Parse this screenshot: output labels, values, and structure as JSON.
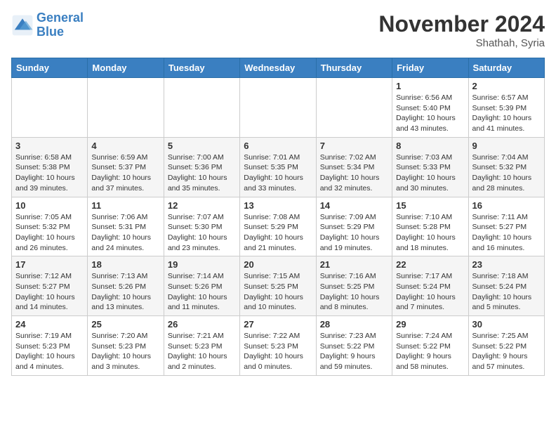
{
  "logo": {
    "line1": "General",
    "line2": "Blue"
  },
  "title": "November 2024",
  "location": "Shathah, Syria",
  "weekdays": [
    "Sunday",
    "Monday",
    "Tuesday",
    "Wednesday",
    "Thursday",
    "Friday",
    "Saturday"
  ],
  "weeks": [
    [
      {
        "day": "",
        "info": ""
      },
      {
        "day": "",
        "info": ""
      },
      {
        "day": "",
        "info": ""
      },
      {
        "day": "",
        "info": ""
      },
      {
        "day": "",
        "info": ""
      },
      {
        "day": "1",
        "info": "Sunrise: 6:56 AM\nSunset: 5:40 PM\nDaylight: 10 hours and 43 minutes."
      },
      {
        "day": "2",
        "info": "Sunrise: 6:57 AM\nSunset: 5:39 PM\nDaylight: 10 hours and 41 minutes."
      }
    ],
    [
      {
        "day": "3",
        "info": "Sunrise: 6:58 AM\nSunset: 5:38 PM\nDaylight: 10 hours and 39 minutes."
      },
      {
        "day": "4",
        "info": "Sunrise: 6:59 AM\nSunset: 5:37 PM\nDaylight: 10 hours and 37 minutes."
      },
      {
        "day": "5",
        "info": "Sunrise: 7:00 AM\nSunset: 5:36 PM\nDaylight: 10 hours and 35 minutes."
      },
      {
        "day": "6",
        "info": "Sunrise: 7:01 AM\nSunset: 5:35 PM\nDaylight: 10 hours and 33 minutes."
      },
      {
        "day": "7",
        "info": "Sunrise: 7:02 AM\nSunset: 5:34 PM\nDaylight: 10 hours and 32 minutes."
      },
      {
        "day": "8",
        "info": "Sunrise: 7:03 AM\nSunset: 5:33 PM\nDaylight: 10 hours and 30 minutes."
      },
      {
        "day": "9",
        "info": "Sunrise: 7:04 AM\nSunset: 5:32 PM\nDaylight: 10 hours and 28 minutes."
      }
    ],
    [
      {
        "day": "10",
        "info": "Sunrise: 7:05 AM\nSunset: 5:32 PM\nDaylight: 10 hours and 26 minutes."
      },
      {
        "day": "11",
        "info": "Sunrise: 7:06 AM\nSunset: 5:31 PM\nDaylight: 10 hours and 24 minutes."
      },
      {
        "day": "12",
        "info": "Sunrise: 7:07 AM\nSunset: 5:30 PM\nDaylight: 10 hours and 23 minutes."
      },
      {
        "day": "13",
        "info": "Sunrise: 7:08 AM\nSunset: 5:29 PM\nDaylight: 10 hours and 21 minutes."
      },
      {
        "day": "14",
        "info": "Sunrise: 7:09 AM\nSunset: 5:29 PM\nDaylight: 10 hours and 19 minutes."
      },
      {
        "day": "15",
        "info": "Sunrise: 7:10 AM\nSunset: 5:28 PM\nDaylight: 10 hours and 18 minutes."
      },
      {
        "day": "16",
        "info": "Sunrise: 7:11 AM\nSunset: 5:27 PM\nDaylight: 10 hours and 16 minutes."
      }
    ],
    [
      {
        "day": "17",
        "info": "Sunrise: 7:12 AM\nSunset: 5:27 PM\nDaylight: 10 hours and 14 minutes."
      },
      {
        "day": "18",
        "info": "Sunrise: 7:13 AM\nSunset: 5:26 PM\nDaylight: 10 hours and 13 minutes."
      },
      {
        "day": "19",
        "info": "Sunrise: 7:14 AM\nSunset: 5:26 PM\nDaylight: 10 hours and 11 minutes."
      },
      {
        "day": "20",
        "info": "Sunrise: 7:15 AM\nSunset: 5:25 PM\nDaylight: 10 hours and 10 minutes."
      },
      {
        "day": "21",
        "info": "Sunrise: 7:16 AM\nSunset: 5:25 PM\nDaylight: 10 hours and 8 minutes."
      },
      {
        "day": "22",
        "info": "Sunrise: 7:17 AM\nSunset: 5:24 PM\nDaylight: 10 hours and 7 minutes."
      },
      {
        "day": "23",
        "info": "Sunrise: 7:18 AM\nSunset: 5:24 PM\nDaylight: 10 hours and 5 minutes."
      }
    ],
    [
      {
        "day": "24",
        "info": "Sunrise: 7:19 AM\nSunset: 5:23 PM\nDaylight: 10 hours and 4 minutes."
      },
      {
        "day": "25",
        "info": "Sunrise: 7:20 AM\nSunset: 5:23 PM\nDaylight: 10 hours and 3 minutes."
      },
      {
        "day": "26",
        "info": "Sunrise: 7:21 AM\nSunset: 5:23 PM\nDaylight: 10 hours and 2 minutes."
      },
      {
        "day": "27",
        "info": "Sunrise: 7:22 AM\nSunset: 5:23 PM\nDaylight: 10 hours and 0 minutes."
      },
      {
        "day": "28",
        "info": "Sunrise: 7:23 AM\nSunset: 5:22 PM\nDaylight: 9 hours and 59 minutes."
      },
      {
        "day": "29",
        "info": "Sunrise: 7:24 AM\nSunset: 5:22 PM\nDaylight: 9 hours and 58 minutes."
      },
      {
        "day": "30",
        "info": "Sunrise: 7:25 AM\nSunset: 5:22 PM\nDaylight: 9 hours and 57 minutes."
      }
    ]
  ]
}
